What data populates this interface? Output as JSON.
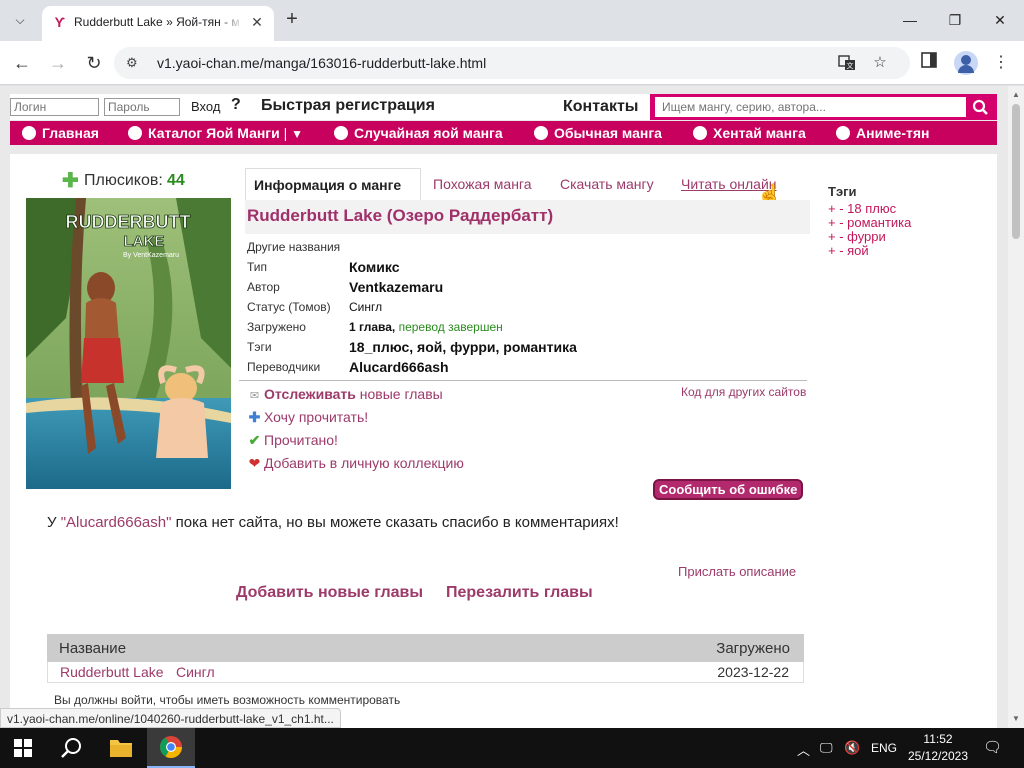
{
  "browser": {
    "tab_title": "Rudderbutt Lake » Яой-тян - м",
    "url": "v1.yaoi-chan.me/manga/163016-rudderbutt-lake.html",
    "status_url": "v1.yaoi-chan.me/online/1040260-rudderbutt-lake_v1_ch1.ht..."
  },
  "topbar": {
    "login_placeholder": "Логин",
    "password_placeholder": "Пароль",
    "enter_label": "Вход",
    "help_label": "?",
    "register_label": "Быстрая регистрация",
    "contacts_label": "Контакты",
    "search_placeholder": "Ищем мангу, серию, автора..."
  },
  "menu": {
    "items": [
      "Главная",
      "Каталог Яой Манги",
      "Случайная яой манга",
      "Обычная манга",
      "Хентай манга",
      "Аниме-тян"
    ]
  },
  "rating": {
    "label": "Плюсиков:",
    "count": "44"
  },
  "tabs": {
    "info": "Информация о манге",
    "similar": "Похожая манга",
    "download": "Скачать мангу",
    "read": "Читать онлайн"
  },
  "manga": {
    "title": "Rudderbutt Lake (Озеро Раддербатт)",
    "cover": {
      "title_line1": "RUDDERBUTT",
      "title_line2": "LAKE",
      "byline": "By VentKazemaru"
    },
    "other_names_label": "Другие названия",
    "type_label": "Тип",
    "type": "Комикс",
    "author_label": "Автор",
    "author": "Ventkazemaru",
    "status_label": "Статус (Томов)",
    "status": "Сингл",
    "uploaded_label": "Загружено",
    "uploaded_count": "1 глава,",
    "uploaded_note": "перевод завершен",
    "tags_label": "Тэги",
    "tags_inline": "18_плюс, яой, фурри, романтика",
    "translators_label": "Переводчики",
    "translator": "Alucard666ash"
  },
  "actions": {
    "track_bold": "Отслеживать",
    "track_rest": "новые главы",
    "want_read": "Хочу прочитать!",
    "read_done": "Прочитано!",
    "add_collection": "Добавить в личную коллекцию",
    "code_link": "Код для других сайтов",
    "report_error": "Сообщить об ошибке"
  },
  "thanks": {
    "prefix": "У",
    "name": "\"Alucard666ash\"",
    "suffix": "пока нет сайта, но вы можете сказать спасибо в комментариях!"
  },
  "links": {
    "send_description": "Прислать описание",
    "add_chapters": "Добавить новые главы",
    "reupload": "Перезалить главы"
  },
  "chapters": {
    "headers": [
      "Название",
      "Загружено"
    ],
    "rows": [
      {
        "name": "Rudderbutt Lake",
        "volume": "Сингл",
        "date": "2023-12-22"
      }
    ]
  },
  "comments": {
    "must_login": "Вы должны войти, чтобы иметь возможность комментировать"
  },
  "sidebar_tags": {
    "title": "Тэги",
    "items": [
      "+ - 18 плюс",
      "+ - романтика",
      "+ - фурри",
      "+ - яой"
    ]
  },
  "taskbar": {
    "language": "ENG",
    "time": "11:52",
    "date": "25/12/2023"
  },
  "colors": {
    "accent": "#c8005e",
    "link": "#9c3a6a",
    "tag": "#c2185b",
    "green": "#2a8a1e"
  }
}
